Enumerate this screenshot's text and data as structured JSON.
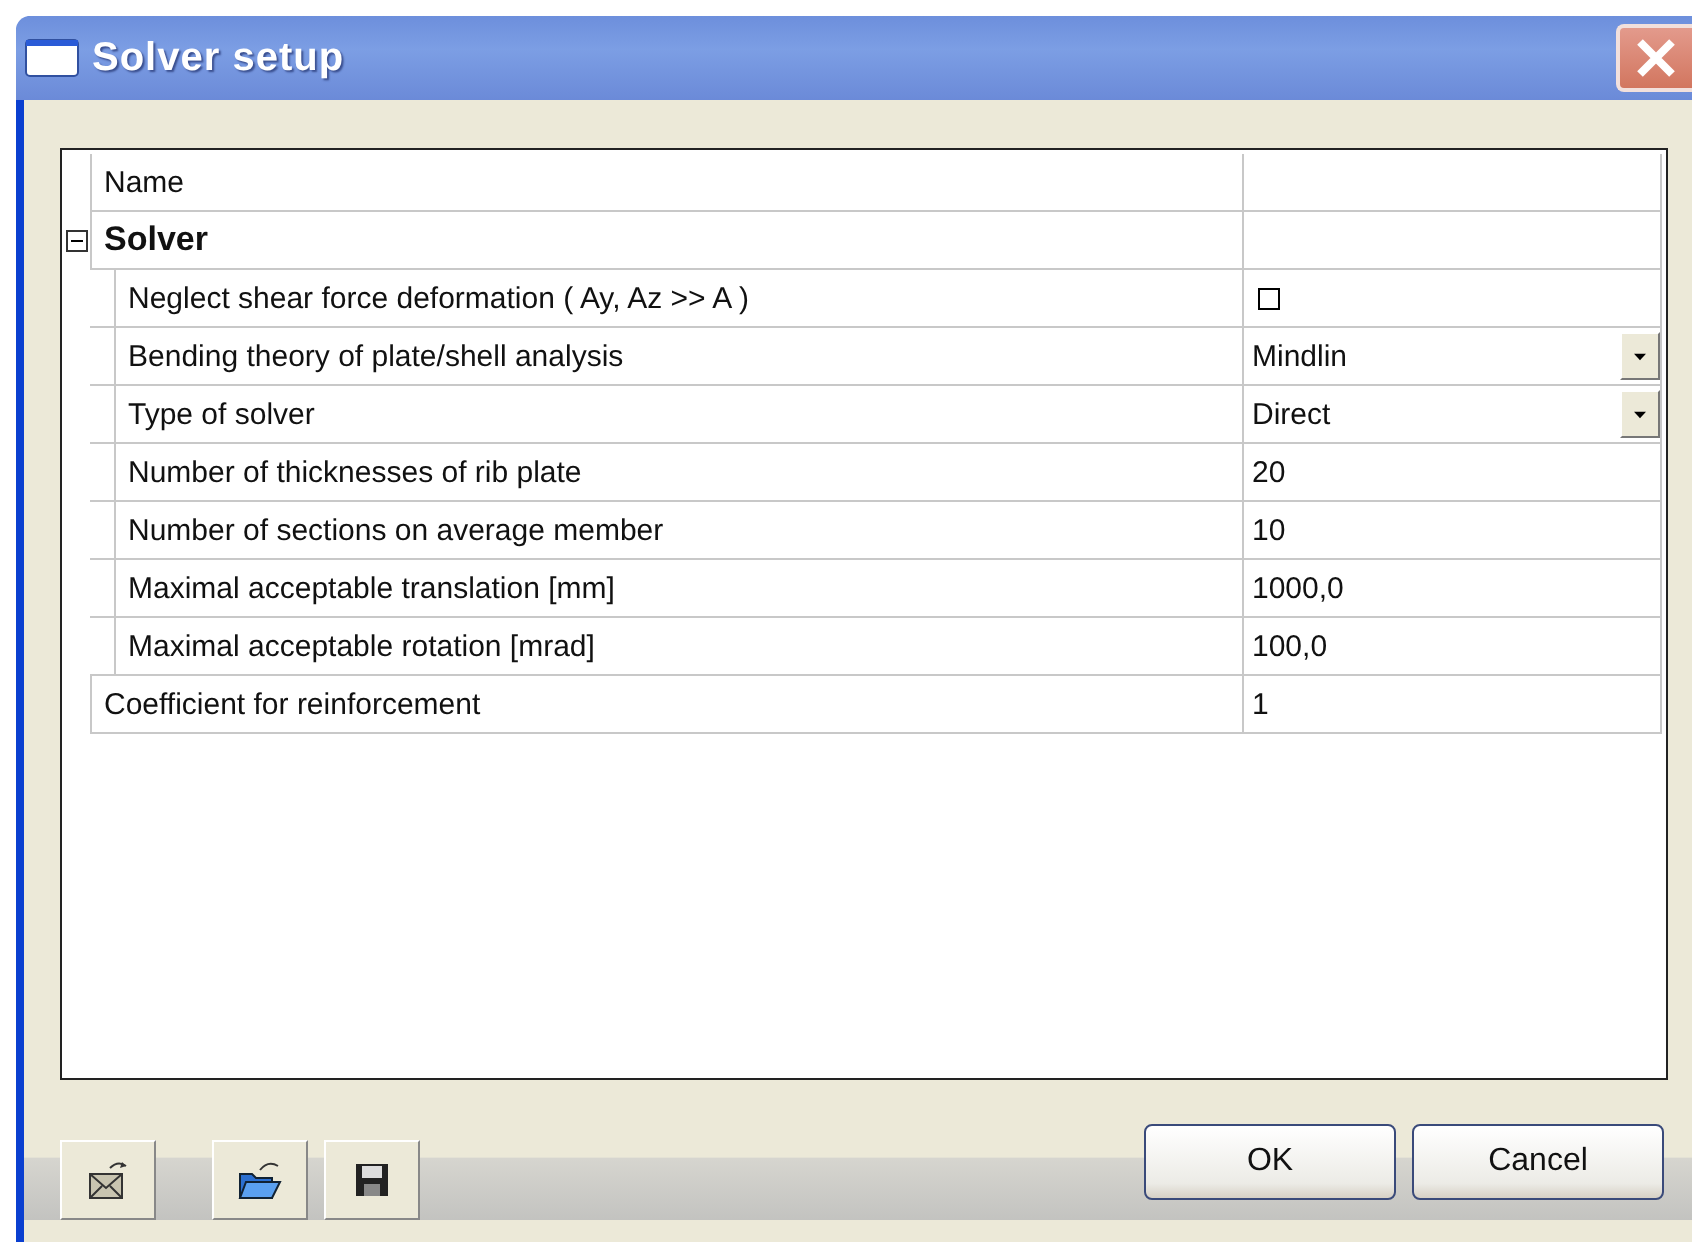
{
  "window": {
    "title": "Solver setup"
  },
  "grid": {
    "header": "Name",
    "rows": [
      {
        "kind": "group",
        "label": "Solver",
        "expanded": true,
        "children": [
          {
            "kind": "checkbox",
            "label": "Neglect shear force deformation ( Ay, Az >> A )",
            "checked": false
          },
          {
            "kind": "dropdown",
            "label": "Bending theory of plate/shell analysis",
            "value": "Mindlin"
          },
          {
            "kind": "dropdown",
            "label": "Type of solver",
            "value": "Direct"
          },
          {
            "kind": "text",
            "label": "Number of thicknesses of rib plate",
            "value": "20"
          },
          {
            "kind": "text",
            "label": "Number of sections on average member",
            "value": "10"
          },
          {
            "kind": "text",
            "label": "Maximal acceptable translation [mm]",
            "value": "1000,0"
          },
          {
            "kind": "text",
            "label": "Maximal acceptable rotation [mrad]",
            "value": "100,0"
          }
        ]
      },
      {
        "kind": "text",
        "label": "Coefficient for reinforcement",
        "value": "1"
      }
    ]
  },
  "buttons": [
    "OK",
    "Cancel"
  ]
}
